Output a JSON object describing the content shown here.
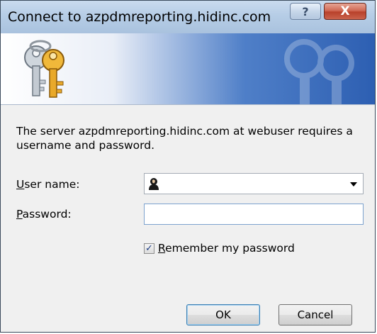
{
  "window": {
    "title": "Connect to azpdmreporting.hidinc.com",
    "help_label": "?",
    "close_label": "X"
  },
  "banner": {
    "icon": "keys-icon",
    "watermark": "keys-watermark"
  },
  "message": "The server azpdmreporting.hidinc.com at webuser requires a username and password.",
  "form": {
    "username_label_accel": "U",
    "username_label_rest": "ser name:",
    "username_value": "",
    "username_icon": "user-icon",
    "password_label_accel": "P",
    "password_label_rest": "assword:",
    "password_value": "",
    "remember_checked": true,
    "remember_accel": "R",
    "remember_rest": "emember my password"
  },
  "buttons": {
    "ok": "OK",
    "cancel": "Cancel"
  },
  "colors": {
    "title_bar": "#b6cde6",
    "banner_blue": "#2d5fb2",
    "close_button": "#c9624c",
    "focus_border": "#3c7fb1"
  }
}
